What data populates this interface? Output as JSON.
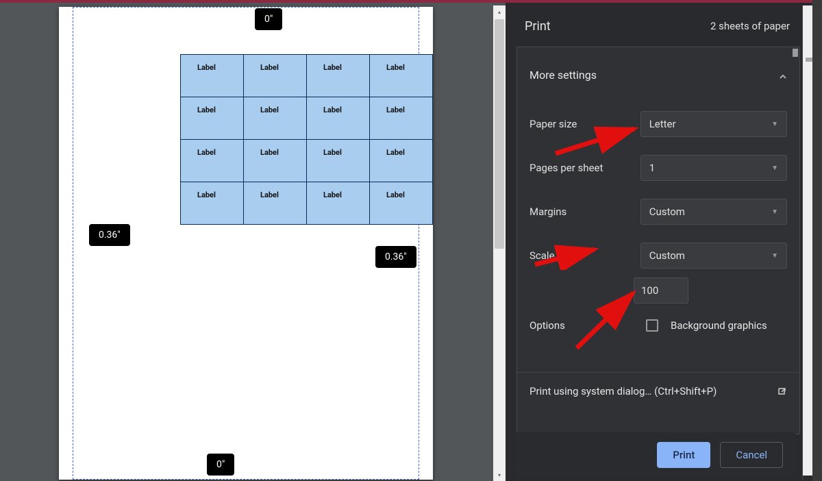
{
  "preview": {
    "margin_top": "0\"",
    "margin_bottom": "0\"",
    "margin_left": "0.36\"",
    "margin_right": "0.36\"",
    "cell_text": "Label",
    "rows": 4,
    "cols": 4
  },
  "panel": {
    "title": "Print",
    "sheets": "2 sheets of paper",
    "more_settings": "More settings",
    "paper_size": {
      "label": "Paper size",
      "value": "Letter"
    },
    "pages_per_sheet": {
      "label": "Pages per sheet",
      "value": "1"
    },
    "margins": {
      "label": "Margins",
      "value": "Custom"
    },
    "scale": {
      "label": "Scale",
      "value": "Custom",
      "number": "100"
    },
    "options": {
      "label": "Options",
      "checkbox_label": "Background graphics",
      "checked": false
    },
    "system_dialog": "Print using system dialog… (Ctrl+Shift+P)",
    "print_btn": "Print",
    "cancel_btn": "Cancel"
  }
}
